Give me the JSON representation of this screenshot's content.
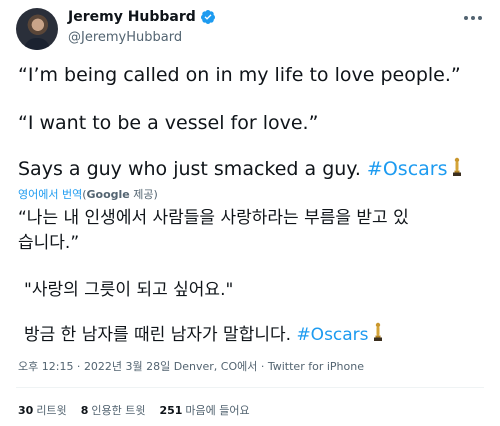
{
  "author": {
    "display_name": "Jeremy Hubbard",
    "handle": "@JeremyHubbard",
    "verified": true
  },
  "colors": {
    "link": "#1d9bf0",
    "secondary": "#536471",
    "text": "#0f1419"
  },
  "icons": {
    "verified": "verified-badge-icon",
    "more": "more-options-icon",
    "hashtag_emoji": "oscar-trophy-icon"
  },
  "tweet": {
    "line1": "“I’m being called on in my life to love people.”",
    "line2": "“I want to be a vessel for love.”",
    "line3_text": "Says a guy who just smacked a guy. ",
    "line3_hashtag": "#Oscars"
  },
  "translation": {
    "label": "영어에서 번역",
    "open_paren": "(",
    "google": "Google",
    "provider_suffix": " 제공)",
    "line1": "“나는 내 인생에서 사람들을 사랑하라는 부름을 받고 있",
    "line2": "습니다.”",
    "line3": "\"사랑의 그릇이 되고 싶어요.\"",
    "line4_text": "방금 한 남자를 때린 남자가 말합니다. ",
    "line4_hashtag": "#Oscars"
  },
  "meta": {
    "time": "오후 12:15",
    "sep1": " · ",
    "date": "2022년 3월 28일",
    "location": " Denver, CO에서",
    "sep2": " · ",
    "source": "Twitter for iPhone"
  },
  "stats": {
    "retweets_count": "30",
    "retweets_label": "리트윗",
    "quotes_count": "8",
    "quotes_label": "인용한 트윗",
    "likes_count": "251",
    "likes_label": "마음에 들어요"
  }
}
